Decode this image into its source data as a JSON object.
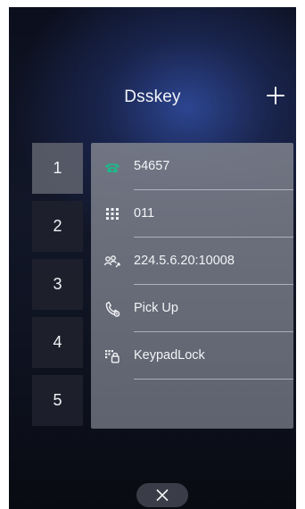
{
  "header": {
    "title": "Dsskey"
  },
  "page_tabs": [
    "1",
    "2",
    "3",
    "4",
    "5"
  ],
  "active_tab": "1",
  "keys": [
    {
      "label": "54657",
      "icon": "phone-icon"
    },
    {
      "label": "011",
      "icon": "keypad-icon"
    },
    {
      "label": "224.5.6.20:10008",
      "icon": "multicast-icon"
    },
    {
      "label": "Pick Up",
      "icon": "pickup-icon"
    },
    {
      "label": "KeypadLock",
      "icon": "keypad-lock-icon"
    }
  ],
  "colors": {
    "phone_green": "#1fb88a"
  }
}
